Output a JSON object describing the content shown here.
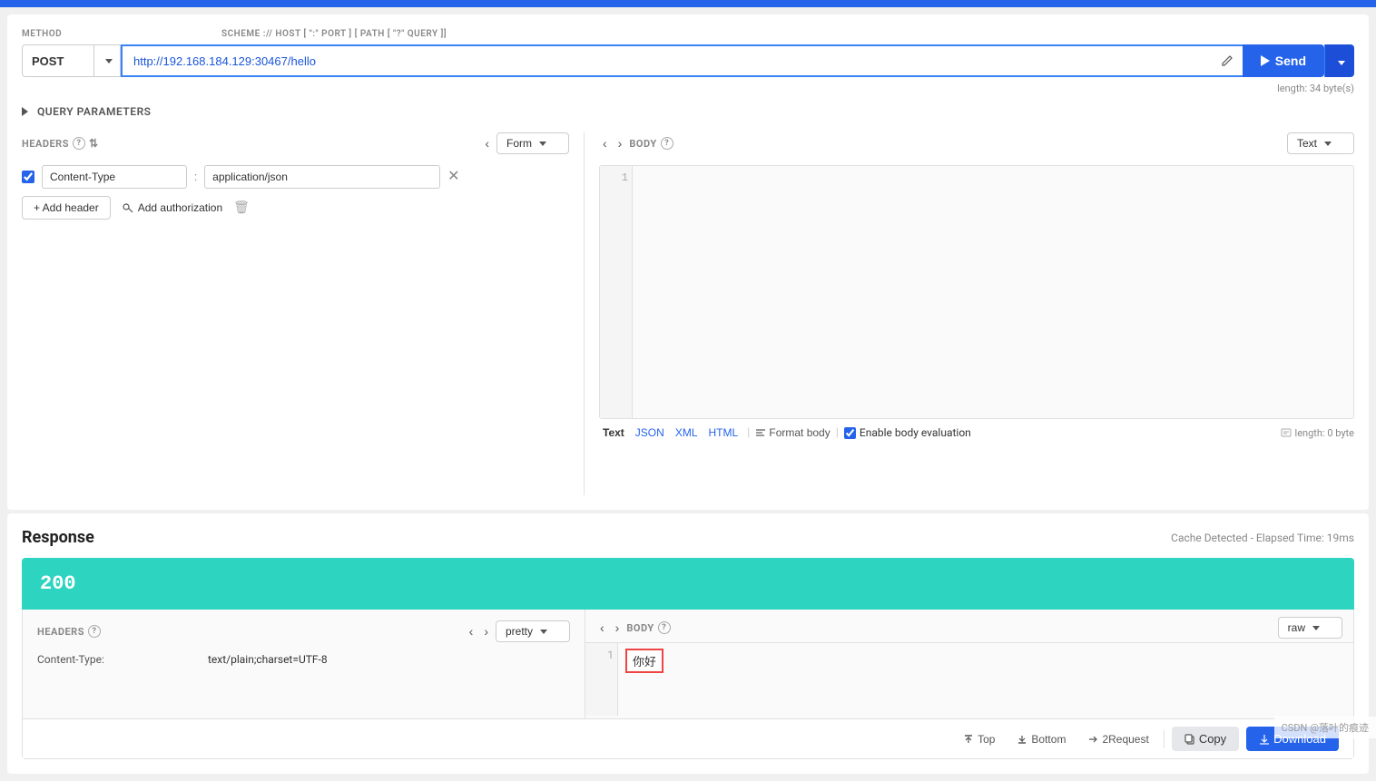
{
  "topBar": {
    "color": "#2563eb"
  },
  "request": {
    "methodLabel": "METHOD",
    "schemeLabel": "SCHEME :// HOST [ \":\" PORT ] [ PATH [ \"?\" QUERY ]]",
    "method": "POST",
    "url": "http://192.168.184.129:30467/hello",
    "urlLength": "length: 34 byte(s)",
    "editIconTitle": "edit",
    "sendLabel": "Send",
    "queryParamsLabel": "QUERY PARAMETERS",
    "headersLabel": "HEADERS",
    "formLabel": "Form",
    "headerKey": "Content-Type",
    "headerValue": "application/json",
    "addHeaderLabel": "+ Add header",
    "addAuthLabel": "Add authorization",
    "bodyLabel": "BODY",
    "textLabel": "Text",
    "bodyTypes": [
      "Text",
      "JSON",
      "XML",
      "HTML"
    ],
    "formatBodyLabel": "Format body",
    "enableEvalLabel": "Enable body evaluation",
    "bodyLength": "length: 0 byte",
    "lineNumber1": "1"
  },
  "response": {
    "title": "Response",
    "elapsedTime": "Cache Detected - Elapsed Time: 19ms",
    "statusCode": "200",
    "headersLabel": "HEADERS",
    "prettyLabel": "pretty",
    "bodyLabel": "BODY",
    "rawLabel": "raw",
    "headerKey1": "Content-Type:",
    "headerVal1": "text/plain;charset=UTF-8",
    "bodyContent": "你好",
    "topLabel": "Top",
    "bottomLabel": "Bottom",
    "toRequestLabel": "2Request",
    "copyLabel": "Copy",
    "downloadLabel": "Download"
  },
  "watermark": "CSDN @落叶的痕迹"
}
